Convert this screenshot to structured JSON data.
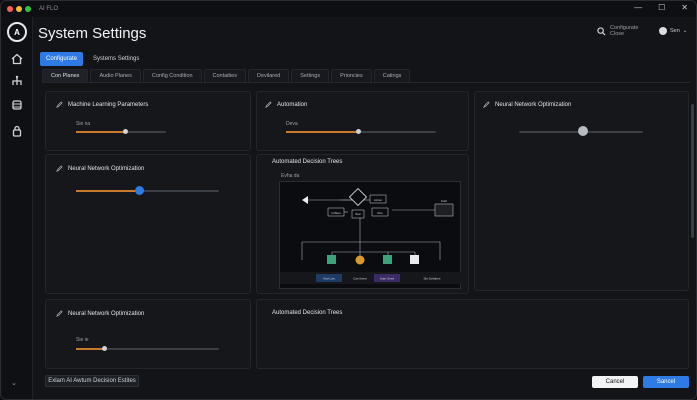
{
  "window": {
    "app_title": "AI FLO"
  },
  "header": {
    "title": "System Settings",
    "search_text": "Configurate Close",
    "user_label": "Sen"
  },
  "top_tabs": [
    {
      "label": "Configurate",
      "active": true
    },
    {
      "label": "Systems Settings",
      "active": false
    }
  ],
  "sub_tabs": [
    {
      "label": "Con Planes",
      "active": true
    },
    {
      "label": "Audio Planes",
      "active": false
    },
    {
      "label": "Config Condition",
      "active": false
    },
    {
      "label": "Contaities",
      "active": false
    },
    {
      "label": "Devilared",
      "active": false
    },
    {
      "label": "Settings",
      "active": false
    },
    {
      "label": "Prioncies",
      "active": false
    },
    {
      "label": "Catings",
      "active": false
    }
  ],
  "panels": {
    "ml_params": {
      "title": "Machine Learning Parameters",
      "slider_label": "Sie na",
      "value": 0.55
    },
    "automation": {
      "title": "Automation",
      "slider_label": "Deva",
      "value": 0.55
    },
    "nn_opt_right": {
      "title": "Neural Network Optimization",
      "value": 0.45
    },
    "nn_opt_mid": {
      "title": "Neural Network Optimization",
      "value": 0.43
    },
    "decision_trees": {
      "title": "Automated Decision Trees",
      "subtitle": "Evha da"
    },
    "nn_opt_bottom": {
      "title": "Neural Network Optimization",
      "slider_label": "Sie ie",
      "value": 0.2
    },
    "decision_trees_bottom": {
      "title": "Automated Decision Trees"
    }
  },
  "diagram": {
    "nodes": {
      "action": "Action",
      "init": "IniSket",
      "start": "Star",
      "kbs": "Kbs",
      "kuhl": "Kuhl"
    },
    "toolbar": [
      "Add Low",
      "Can thens",
      "Start Seed",
      "Sla Soltabee"
    ]
  },
  "footer": {
    "left_button": "Exlam AI Awtum Decision Estites",
    "cancel": "Cancel",
    "save": "Sancel"
  },
  "colors": {
    "accent": "#2e7be6",
    "slider_fill": "#c97a2a",
    "blue_knob": "#2e7be6"
  }
}
